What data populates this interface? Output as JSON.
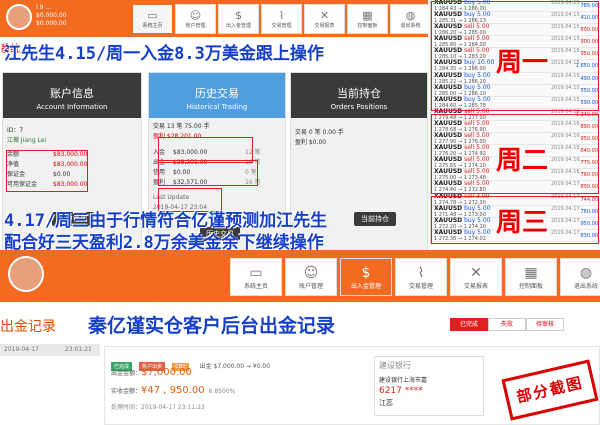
{
  "top_user": {
    "name": "I 9 ...",
    "balance": "$0.000.00",
    "meta": "$0.000.00"
  },
  "top_nav": [
    {
      "label": "系统主页",
      "icon": "home-icon"
    },
    {
      "label": "账户管理",
      "icon": "user-icon"
    },
    {
      "label": "出入金管理",
      "icon": "money-icon"
    },
    {
      "label": "交易管理",
      "icon": "chart-icon"
    },
    {
      "label": "交易报表",
      "icon": "wrench-icon"
    },
    {
      "label": "控制面板",
      "icon": "grid-icon"
    },
    {
      "label": "退出系统",
      "icon": "basketball-icon"
    }
  ],
  "sys_label": "系统",
  "caption1": "江先生4.15/周一入金8.3万美金跟上操作",
  "caption2a": "4.17/周三由于行情符合亿谨预测加江先生",
  "caption2b": "配合好三天盈利2.8万余美金余下继续操作",
  "account_panel": {
    "title": "账户信息",
    "subtitle": "Account Information",
    "id_label": "ID：7",
    "name": "江薇 Jiang Lei",
    "rows": [
      {
        "label": "余额",
        "value": "$83,000.00"
      },
      {
        "label": "净值",
        "value": "$83,000.00"
      },
      {
        "label": "保证金",
        "value": "$0.00"
      },
      {
        "label": "可用保证金",
        "value": "$83,000.00"
      }
    ],
    "button": "账户管理"
  },
  "history_panel": {
    "title": "历史交易",
    "subtitle": "Historical Trading",
    "top_rows": [
      {
        "text": "交易 13 笔  75.00 手"
      },
      {
        "text": "盈利 $28,201.00"
      }
    ],
    "rows": [
      {
        "label": "入金",
        "value": "$83,000.00",
        "count": "12 笔"
      },
      {
        "label": "出金",
        "value": "$28,201.00",
        "count": "16 笔"
      },
      {
        "label": "信用",
        "value": "$0.00",
        "count": "0 笔"
      },
      {
        "label": "盈利",
        "value": "$32,571.00",
        "count": "16 笔"
      }
    ],
    "last_update_label": "Last Update",
    "last_update": "2019-04-17 23:04",
    "button": "历史交易"
  },
  "positions_panel": {
    "title": "当前持仓",
    "subtitle": "Orders Positions",
    "rows": [
      {
        "text": "交易 0 笔  0.00 手"
      },
      {
        "text": "盈利 $0.00"
      }
    ],
    "button": "当前持仓"
  },
  "trades": [
    {
      "sym": "XAUUSD",
      "side": "buy",
      "lots": "5.00",
      "price": "1 284.43 → 1 286.00",
      "date": "2019.04.15 ...",
      "pl": "785.00"
    },
    {
      "sym": "XAUUSD",
      "side": "buy",
      "lots": "5.00",
      "price": "1 285.31 → 1 286.13",
      "date": "2019.04.15 ...",
      "pl": "410.00"
    },
    {
      "sym": "XAUUSD",
      "side": "sell",
      "lots": "5.00",
      "price": "1 286.20 → 1 285.00",
      "date": "2019.04.15 ...",
      "pl": "600.00"
    },
    {
      "sym": "XAUUSD",
      "side": "sell",
      "lots": "5.00",
      "price": "1 285.80 → 1 284.00",
      "date": "2019.04.15 ...",
      "pl": "900.00"
    },
    {
      "sym": "XAUUSD",
      "side": "sell",
      "lots": "5.00",
      "price": "1 285.10 → 1 283.20",
      "date": "2019.04.15 ...",
      "pl": "950.00"
    },
    {
      "sym": "XAUUSD",
      "side": "buy",
      "lots": "10.00",
      "price": "1 284.35 → 1 286.00",
      "date": "2019.04.15 ...",
      "pl": "1 650.00"
    },
    {
      "sym": "XAUUSD",
      "side": "buy",
      "lots": "5.00",
      "price": "1 285.22 → 1 286.20",
      "date": "2019.04.15 ...",
      "pl": "490.00"
    },
    {
      "sym": "XAUUSD",
      "side": "buy",
      "lots": "5.00",
      "price": "1 285.00 → 1 286.10",
      "date": "2019.04.15 ...",
      "pl": "550.00"
    },
    {
      "sym": "XAUUSD",
      "side": "buy",
      "lots": "5.00",
      "price": "1 284.60 → 1 285.78",
      "date": "2019.04.15 ...",
      "pl": "590.00"
    },
    {
      "sym": "XAUUSD",
      "side": "sell",
      "lots": "5.00",
      "price": "1 279.48 → 1 277.00",
      "date": "2019.04.16 ...",
      "pl": "1 240.00"
    },
    {
      "sym": "XAUUSD",
      "side": "sell",
      "lots": "5.00",
      "price": "1 278.68 → 1 276.90",
      "date": "2019.04.16 ...",
      "pl": "890.00"
    },
    {
      "sym": "XAUUSD",
      "side": "sell",
      "lots": "5.00",
      "price": "1 277.90 → 1 276.00",
      "date": "2019.04.16 ...",
      "pl": "950.00"
    },
    {
      "sym": "XAUUSD",
      "side": "sell",
      "lots": "5.00",
      "price": "1 276.20 → 1 274.92",
      "date": "2019.04.16 ...",
      "pl": "640.00"
    },
    {
      "sym": "XAUUSD",
      "side": "sell",
      "lots": "5.00",
      "price": "1 275.65 → 1 274.10",
      "date": "2019.04.16 ...",
      "pl": "775.00"
    },
    {
      "sym": "XAUUSD",
      "side": "sell",
      "lots": "5.00",
      "price": "1 275.00 → 1 273.48",
      "date": "2019.04.16 ...",
      "pl": "760.00"
    },
    {
      "sym": "XAUUSD",
      "side": "sell",
      "lots": "5.00",
      "price": "1 274.40 → 1 272.80",
      "date": "2019.04.17 ...",
      "pl": "800.00"
    },
    {
      "sym": "XAUUSD",
      "side": "sell",
      "lots": "3.00",
      "price": "1 274.78 → 1 272.30",
      "date": "2019.04.17 ...",
      "pl": "744.00"
    },
    {
      "sym": "XAUUSD",
      "side": "buy",
      "lots": "5.00",
      "price": "1 271.48 → 1 273.00",
      "date": "2019.04.17 ...",
      "pl": "760.00"
    },
    {
      "sym": "XAUUSD",
      "side": "buy",
      "lots": "5.00",
      "price": "1 272.20 → 1 274.10",
      "date": "2019.04.17 ...",
      "pl": "950.00"
    },
    {
      "sym": "XAUUSD",
      "side": "buy",
      "lots": "5.00",
      "price": "1 272.36 → 1 274.02",
      "date": "2019.04.17 ...",
      "pl": "830.00"
    }
  ],
  "week_labels": [
    "周一",
    "周二",
    "周三"
  ],
  "bottom_nav": [
    {
      "label": "系统主页",
      "icon": "home-icon"
    },
    {
      "label": "账户管理",
      "icon": "user-icon"
    },
    {
      "label": "出入金管理",
      "icon": "money-icon"
    },
    {
      "label": "交易管理",
      "icon": "chart-icon"
    },
    {
      "label": "交易报表",
      "icon": "wrench-icon"
    },
    {
      "label": "控制面板",
      "icon": "grid-icon"
    },
    {
      "label": "退出系统",
      "icon": "basketball-icon"
    }
  ],
  "withdraw_label": "出金记录",
  "title2": "秦亿谨实仓客户后台出金记录",
  "status_tabs": [
    "已完成",
    "失败",
    "待审核"
  ],
  "record_date": "2019-04-17",
  "record_time": "23:01:21",
  "record_card": {
    "chips": [
      "已完成",
      "账户出金",
      "CNY"
    ],
    "header": "出金 $7,000.00 → ¥0.00",
    "amount_label": "出金金额：",
    "amount": "$7,000.00",
    "actual_label": "实收金额：",
    "actual": "¥47 , 950.00",
    "rate": "6.8500%",
    "time_label": "处理时间：",
    "time": "2019-04-17 23:11:23"
  },
  "bank": {
    "name": "建设银行",
    "branch": "建设银行上海市嘉",
    "acct": "6217 ****",
    "holder": "江蕊"
  },
  "stamp": "部分截图"
}
